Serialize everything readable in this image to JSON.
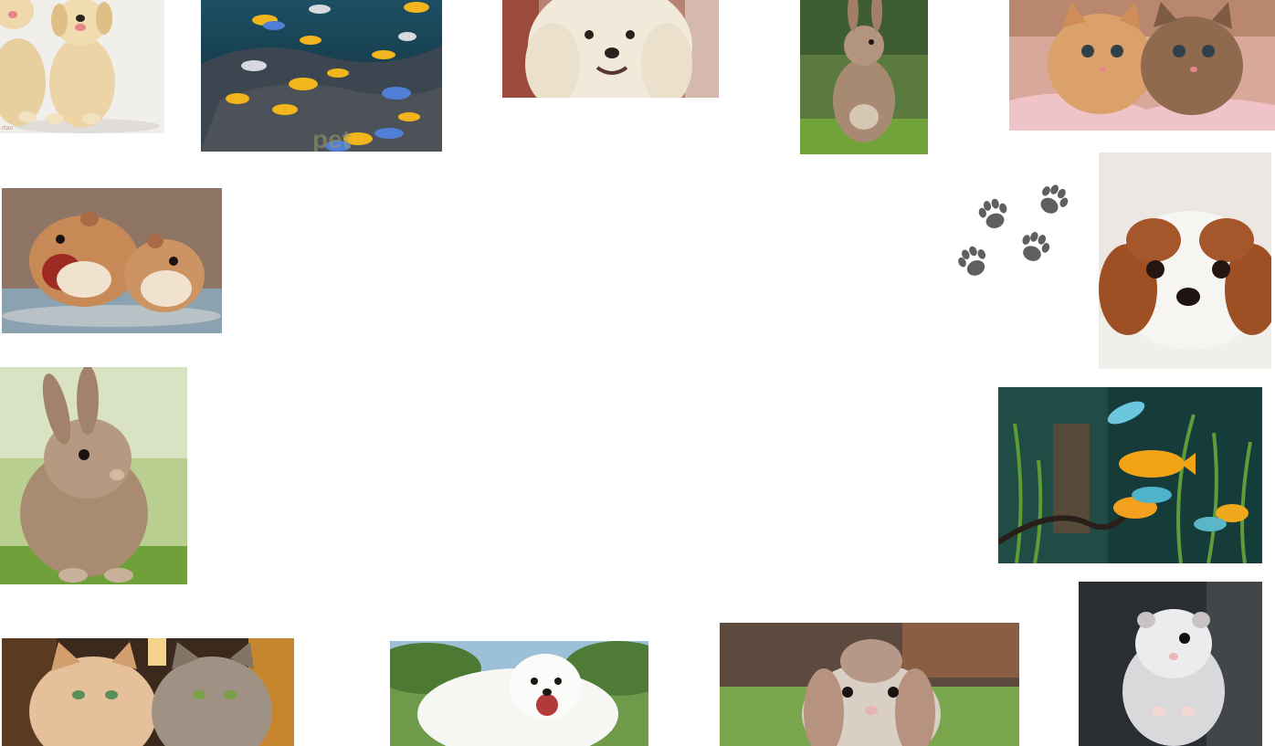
{
  "page": {
    "background": "#ffffff",
    "decoration": {
      "icon": "paw-prints-icon",
      "color": "#5f5f5f"
    }
  },
  "gallery": {
    "photos": [
      {
        "id": "puppies",
        "icon": "golden-retriever-puppies-photo",
        "watermark": "rfoto"
      },
      {
        "id": "fish1",
        "icon": "aquarium-cichlid-fish-photo",
        "watermark": "pet"
      },
      {
        "id": "maltese",
        "icon": "white-maltese-dog-photo"
      },
      {
        "id": "rabbit1",
        "icon": "brown-rabbit-on-grass-photo"
      },
      {
        "id": "kittens",
        "icon": "two-kittens-on-blanket-photo"
      },
      {
        "id": "hamsters",
        "icon": "two-hamsters-photo"
      },
      {
        "id": "spaniel",
        "icon": "cavalier-king-charles-spaniel-photo"
      },
      {
        "id": "rabbit2",
        "icon": "fluffy-bunny-photo"
      },
      {
        "id": "fish2",
        "icon": "aquarium-fish-photo"
      },
      {
        "id": "cats",
        "icon": "two-long-haired-cats-photo"
      },
      {
        "id": "samoyed",
        "icon": "samoyed-dog-photo"
      },
      {
        "id": "lop",
        "icon": "lop-eared-rabbit-photo"
      },
      {
        "id": "hamster2",
        "icon": "white-dwarf-hamster-photo"
      }
    ]
  }
}
